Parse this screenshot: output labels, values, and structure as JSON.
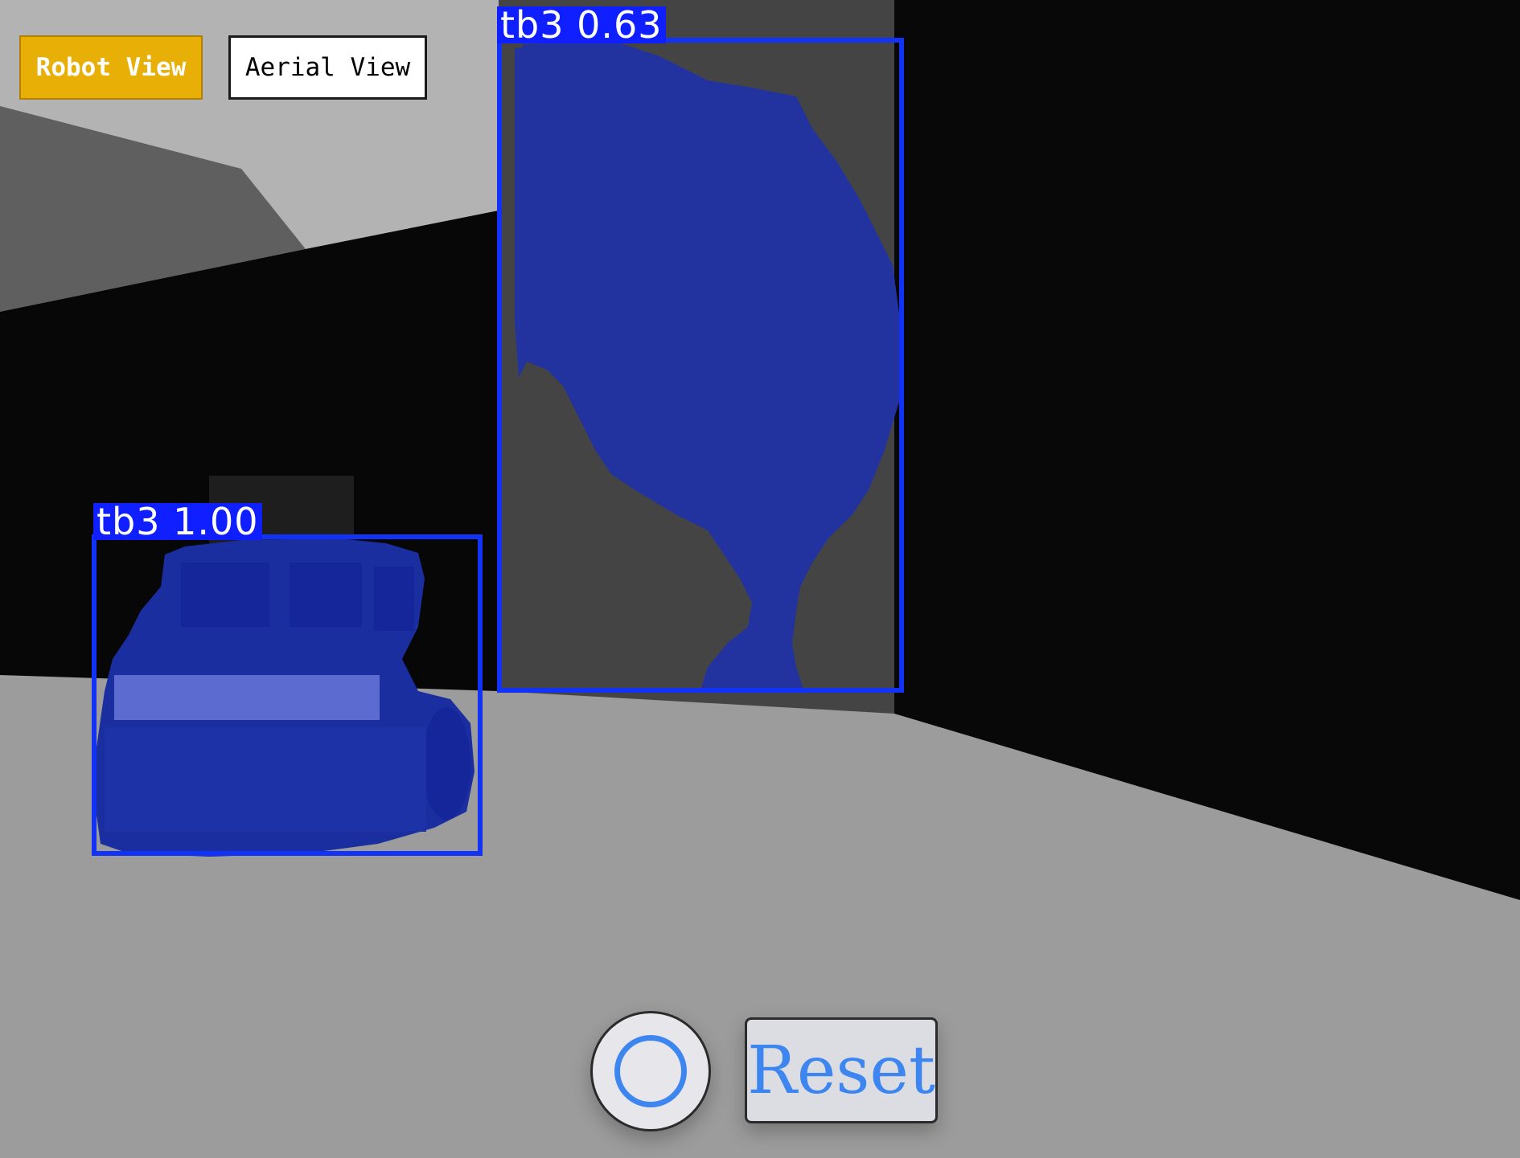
{
  "view_toggle": {
    "robot_view_label": "Robot View",
    "aerial_view_label": "Aerial View",
    "active_view": "Robot View"
  },
  "detections": [
    {
      "class_label": "tb3",
      "confidence": "0.63",
      "display": "tb3 0.63"
    },
    {
      "class_label": "tb3",
      "confidence": "1.00",
      "display": "tb3 1.00"
    }
  ],
  "controls": {
    "record_icon": "circle-record-icon",
    "reset_label": "Reset"
  },
  "colors": {
    "active_view_bg": "#e8b007",
    "detection_color": "#1232f5",
    "control_accent": "#3d86f0"
  }
}
